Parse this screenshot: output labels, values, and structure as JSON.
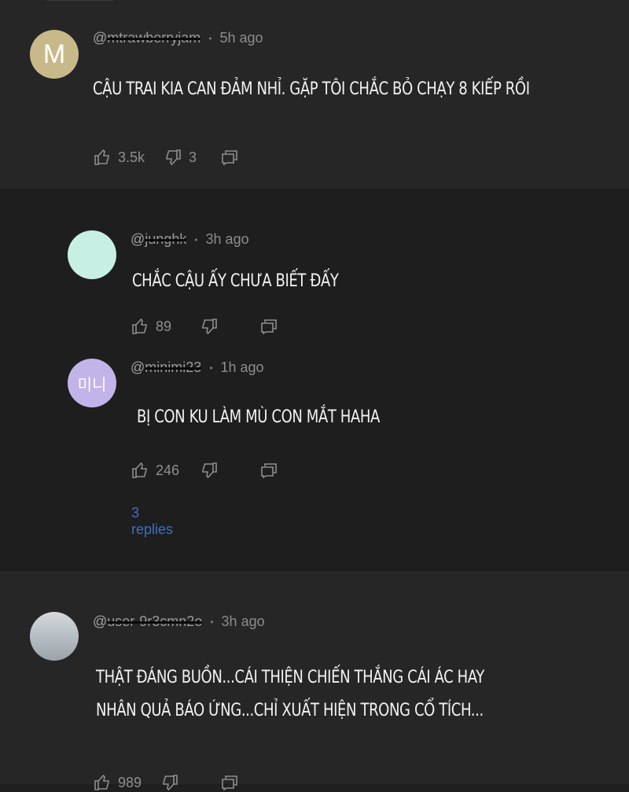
{
  "comments": [
    {
      "avatar_letter": "M",
      "avatar_color": "#c8b98a",
      "at": "@",
      "handle": "mtrawberryjam",
      "time": "5h ago",
      "text": "CẬU TRAI KIA CAN ĐẢM NHỈ. GẶP TÔI CHẮC BỎ CHẠY 8 KIẾP RỒI",
      "likes": "3.5k",
      "dislikes": "3"
    },
    {
      "avatar_letter": "",
      "avatar_color": "#c8efe3",
      "at": "@",
      "handle": "junghk",
      "time": "3h ago",
      "text": "CHẮC CẬU ẤY CHƯA BIẾT ĐẤY",
      "likes": "89",
      "dislikes": ""
    },
    {
      "avatar_letter": "미니",
      "avatar_color": "#c2b4e8",
      "at": "@",
      "handle": "minimi23",
      "time": "1h ago",
      "text": "BỊ CON KU LÀM MÙ CON MẮT HAHA",
      "likes": "246",
      "dislikes": "",
      "replies": "3 replies"
    },
    {
      "avatar_letter": "",
      "avatar_color": "#b9c2c8",
      "at": "@",
      "handle": "user-9r3cmn2o",
      "time": "3h ago",
      "text_line1": "THẬT ĐÁNG BUỒN...CÁI THIỆN CHIẾN THẮNG CÁI ÁC HAY",
      "text_line2": "NHÂN QUẢ BÁO ỨNG...CHỈ XUẤT HIỆN TRONG CỔ TÍCH...",
      "likes": "989",
      "dislikes": ""
    }
  ],
  "icons": {
    "like": "thumb-up-icon",
    "dislike": "thumb-down-icon",
    "reply": "reply-icon"
  }
}
